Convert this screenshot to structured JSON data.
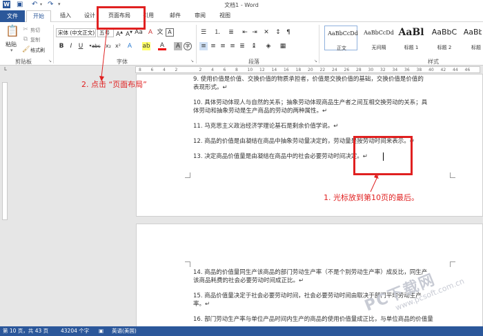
{
  "window": {
    "title": "文档1 - Word"
  },
  "tabs": [
    {
      "id": "file",
      "label": "文件"
    },
    {
      "id": "home",
      "label": "开始"
    },
    {
      "id": "insert",
      "label": "插入"
    },
    {
      "id": "design",
      "label": "设计"
    },
    {
      "id": "layout",
      "label": "页面布局"
    },
    {
      "id": "references",
      "label": "引用"
    },
    {
      "id": "mailings",
      "label": "邮件"
    },
    {
      "id": "review",
      "label": "审阅"
    },
    {
      "id": "view",
      "label": "视图"
    }
  ],
  "ribbon": {
    "clipboard": {
      "label": "剪贴板",
      "paste": "粘贴",
      "cut": "剪切",
      "copy": "复制",
      "format_painter": "格式刷"
    },
    "font": {
      "label": "字体",
      "font_name": "宋体 (中文正文)",
      "font_size": "五号"
    },
    "paragraph": {
      "label": "段落"
    },
    "styles": {
      "label": "样式",
      "items": [
        {
          "sample": "AaBbCcDd",
          "name": "正文"
        },
        {
          "sample": "AaBbCcDd",
          "name": "无间隔"
        },
        {
          "sample": "AaBl",
          "name": "标题 1"
        },
        {
          "sample": "AaBbC",
          "name": "标题 2"
        },
        {
          "sample": "AaBbC",
          "name": "标题"
        }
      ]
    }
  },
  "ruler": {
    "ticks": [
      "8",
      "6",
      "4",
      "2",
      "",
      "2",
      "4",
      "6",
      "8",
      "10",
      "12",
      "14",
      "16",
      "18",
      "20",
      "22",
      "24",
      "26",
      "28",
      "30",
      "32",
      "34",
      "36",
      "38",
      "40",
      "42",
      "44",
      "46"
    ]
  },
  "document": {
    "page1_lines": [
      "9. 使用价值是价值、交换价值的物质承担者，价值是交换价值的基础，交换价值是价值的",
      "表现形式。↵",
      "10. 具体劳动体现人与自然的关系；抽象劳动体现商品生产者之间互相交换劳动的关系；具",
      "体劳动和抽象劳动是生产商品的劳动的两种属性。↵",
      "11. 马克思主义政治经济学理论基石是剩余价值学说。↵",
      "12. 商品的价值是由凝结在商品中抽象劳动量决定的，劳动量是按劳动时间来表示。↵",
      "13. 决定商品价值量是由凝结在商品中的社会必要劳动时间决定。↵"
    ],
    "page2_lines": [
      "14. 商品的价值量同生产该商品的部门劳动生产率（不是个别劳动生产率）成反比，同生产",
      "该商品耗费的社会必要劳动时间成正比。↵",
      "15. 商品价值量决定于社会必要劳动时间，社会必要劳动时间由取决于部门平均劳动生产",
      "率。↵",
      "16. 部门劳动生产率与单位产品时间内生产的商品的使用价值量成正比，与单位商品的价值量"
    ]
  },
  "annotations": {
    "step1": "1. 光标放到第10页的最后。",
    "step2": "2. 点击 “页面布局”"
  },
  "status": {
    "page": "第 10 页，共 43 页",
    "words": "43204 个字",
    "language": "英语(美国)"
  },
  "watermark": {
    "main": "PC下载网",
    "sub": "www.pcsoft.com.cn"
  },
  "colors": {
    "accent": "#2b579a",
    "annotation": "#e02020"
  }
}
